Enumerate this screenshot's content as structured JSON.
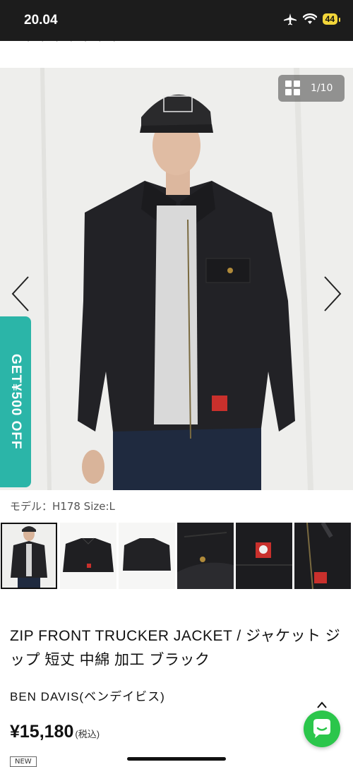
{
  "status_bar": {
    "time": "20.04",
    "battery": "44"
  },
  "gallery": {
    "counter": "1/10"
  },
  "promo": {
    "label": "GET¥500 OFF"
  },
  "model_info": "モデル：H178 Size:L",
  "thumbnails": [
    "thumb-1",
    "thumb-2",
    "thumb-3",
    "thumb-4",
    "thumb-5",
    "thumb-6"
  ],
  "product": {
    "title": "ZIP FRONT TRUCKER JACKET / ジャケット ジップ 短丈 中綿 加工 ブラック",
    "brand": "BEN DAVIS(ベンデイビス)",
    "price": "¥15,180",
    "tax_note": "(税込)",
    "badge": "NEW"
  },
  "colors": {
    "accent_teal": "#2bb5a8",
    "chat_green": "#2bc64b",
    "status_bg": "#1c1c1c"
  }
}
